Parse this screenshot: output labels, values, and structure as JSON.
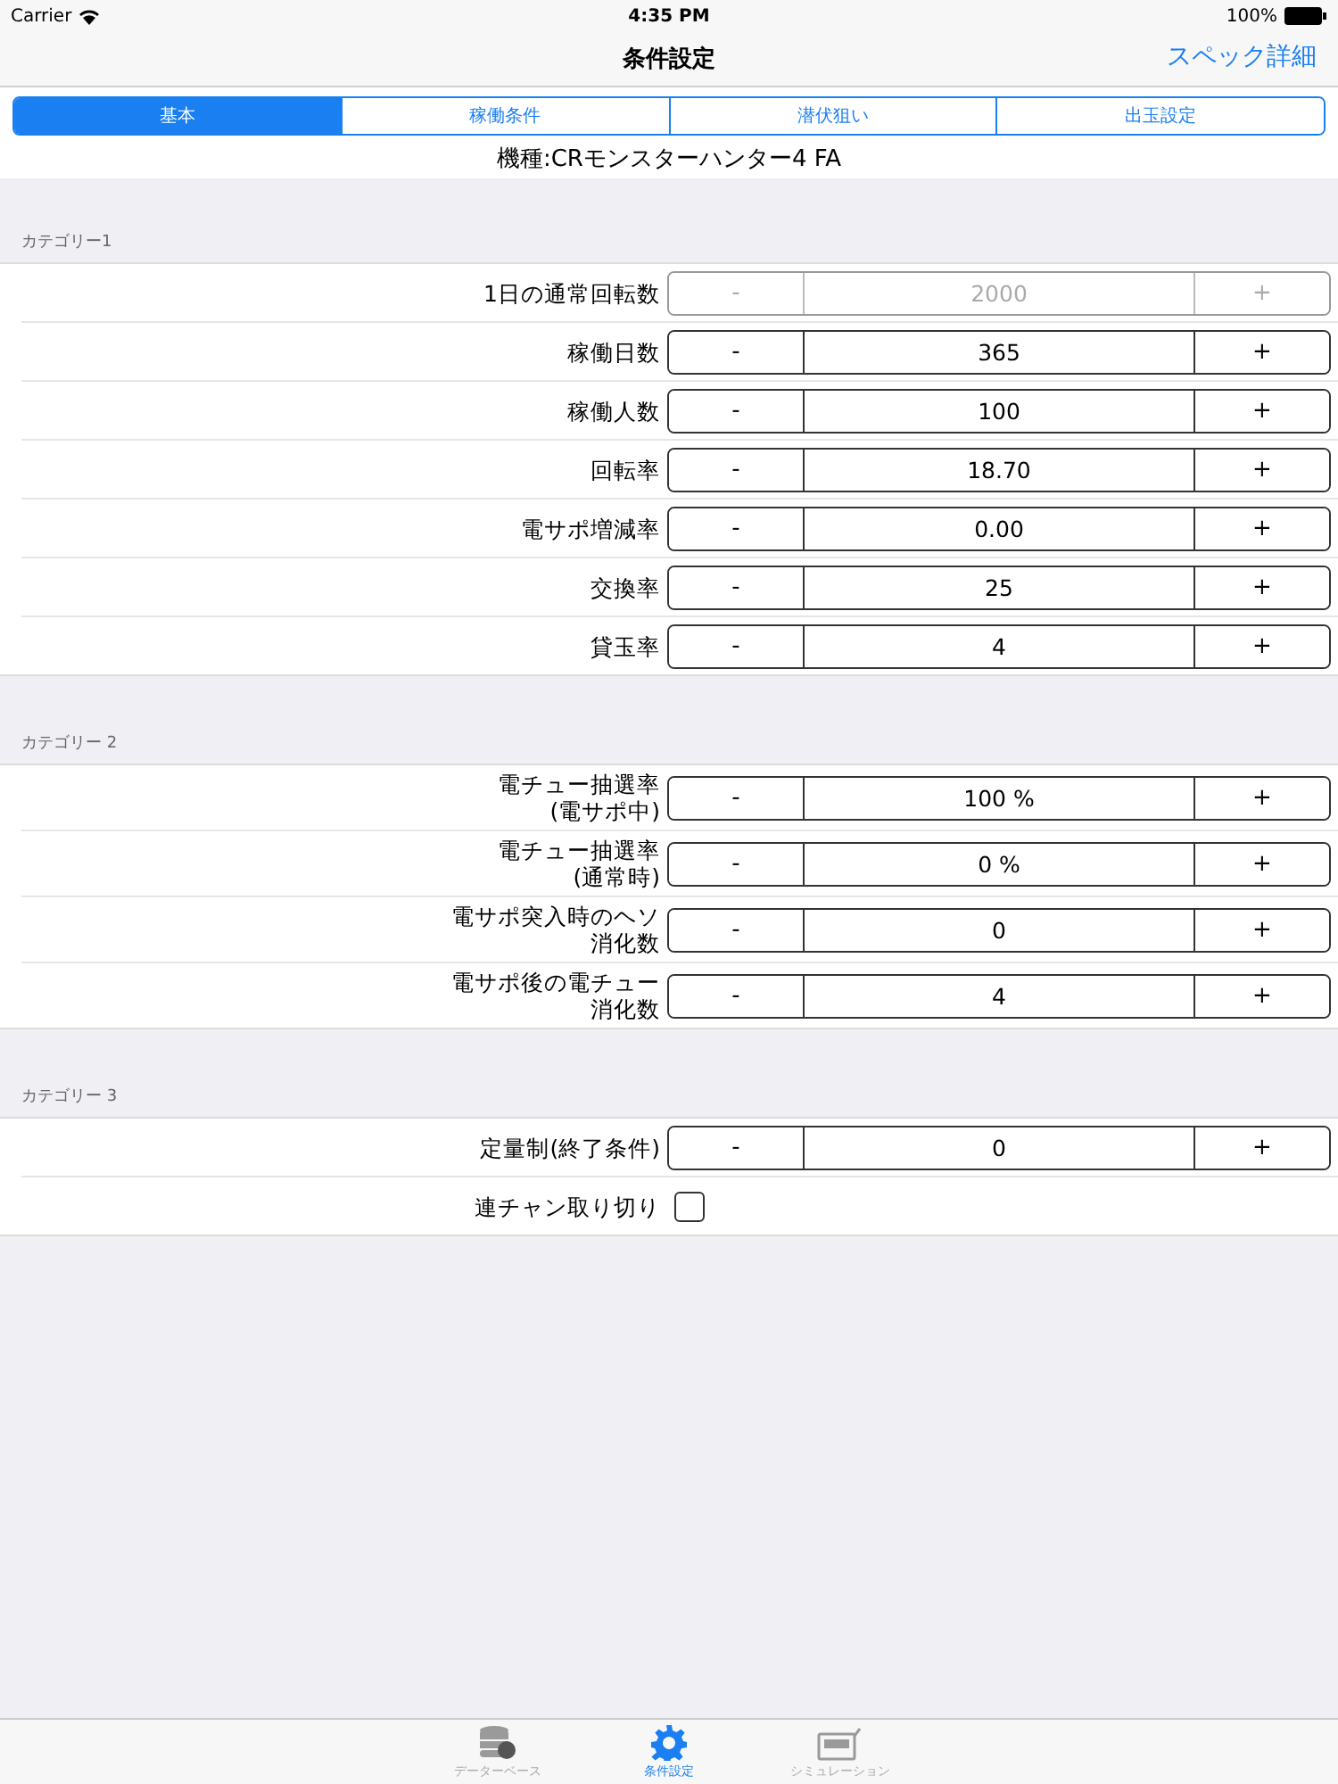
{
  "status_bar": {
    "carrier": "Carrier",
    "time": "4:35 PM",
    "battery": "100%"
  },
  "nav": {
    "title": "条件設定",
    "action": "スペック詳細"
  },
  "tabs": [
    {
      "label": "基本",
      "selected": true
    },
    {
      "label": "稼働条件",
      "selected": false
    },
    {
      "label": "潜伏狙い",
      "selected": false
    },
    {
      "label": "出玉設定",
      "selected": false
    }
  ],
  "model": "機種:CRモンスターハンター4 FA",
  "sections": [
    {
      "header": "カテゴリー1",
      "rows": [
        {
          "kind": "stepper",
          "label": "1日の通常回転数",
          "minus": "-",
          "value": "2000",
          "plus": "+",
          "disabled": true
        },
        {
          "kind": "stepper",
          "label": "稼働日数",
          "minus": "-",
          "value": "365",
          "plus": "+",
          "disabled": false
        },
        {
          "kind": "stepper",
          "label": "稼働人数",
          "minus": "-",
          "value": "100",
          "plus": "+",
          "disabled": false
        },
        {
          "kind": "stepper",
          "label": "回転率",
          "minus": "-",
          "value": "18.70",
          "plus": "+",
          "disabled": false
        },
        {
          "kind": "stepper",
          "label": "電サポ増減率",
          "minus": "-",
          "value": "0.00",
          "plus": "+",
          "disabled": false
        },
        {
          "kind": "stepper",
          "label": "交換率",
          "minus": "-",
          "value": "25",
          "plus": "+",
          "disabled": false
        },
        {
          "kind": "stepper",
          "label": "貸玉率",
          "minus": "-",
          "value": "4",
          "plus": "+",
          "disabled": false
        }
      ]
    },
    {
      "header": "カテゴリー 2",
      "rows": [
        {
          "kind": "stepper",
          "label": "電チュー抽選率",
          "label_line2": "(電サポ中)",
          "minus": "-",
          "value": "100 %",
          "plus": "+",
          "disabled": false
        },
        {
          "kind": "stepper",
          "label": "電チュー抽選率",
          "label_line2": "(通常時)",
          "minus": "-",
          "value": "0 %",
          "plus": "+",
          "disabled": false
        },
        {
          "kind": "stepper",
          "label": "電サポ突入時のヘソ",
          "label_line2": "消化数",
          "minus": "-",
          "value": "0",
          "plus": "+",
          "disabled": false
        },
        {
          "kind": "stepper",
          "label": "電サポ後の電チュー",
          "label_line2": "消化数",
          "minus": "-",
          "value": "4",
          "plus": "+",
          "disabled": false
        }
      ]
    },
    {
      "header": "カテゴリー 3",
      "rows": [
        {
          "kind": "stepper",
          "label": "定量制(終了条件)",
          "minus": "-",
          "value": "0",
          "plus": "+",
          "disabled": false
        },
        {
          "kind": "checkbox",
          "label": "連チャン取り切り",
          "checked": false
        }
      ]
    }
  ],
  "tab_bar": [
    {
      "kind": "database",
      "label": "データーベース",
      "selected": false
    },
    {
      "kind": "gear",
      "label": "条件設定",
      "selected": true
    },
    {
      "kind": "machine",
      "label": "シミュレーション",
      "selected": false
    }
  ]
}
